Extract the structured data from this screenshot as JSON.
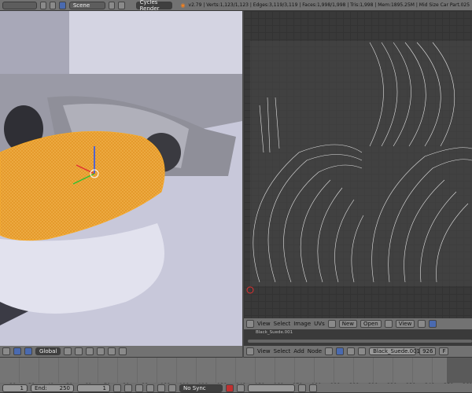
{
  "topbar": {
    "scene": "Scene",
    "engine": "Cycles Render",
    "stats": "v2.79 | Verts:1,123/1,123 | Edges:3,119/3,119 | Faces:1,998/1,998 | Tris:1,998 | Mem:1895.25M | Mid Size Car Part.025"
  },
  "viewport_header": {
    "orientation": "Global"
  },
  "uv_header": {
    "menus": [
      "View",
      "Select",
      "Image",
      "UVs"
    ],
    "new": "New",
    "open": "Open",
    "view": "View"
  },
  "node_editor": {
    "material_label": "Black_Suede.001",
    "menus": [
      "View",
      "Select",
      "Add",
      "Node"
    ],
    "material": "Black_Suede.001",
    "users": "926",
    "fake": "F"
  },
  "timeline": {
    "ticks": [
      "20",
      "30",
      "40",
      "50",
      "60",
      "70",
      "80",
      "90",
      "100",
      "110",
      "120",
      "130",
      "140",
      "150",
      "160",
      "170",
      "180",
      "190",
      "200",
      "210",
      "220",
      "230",
      "240",
      "250",
      "260"
    ],
    "start": "1",
    "end_label": "End:",
    "end": "250",
    "current": "1",
    "sync": "No Sync"
  },
  "colors": {
    "selection": "#f5a623",
    "uv_bg": "#393939"
  }
}
